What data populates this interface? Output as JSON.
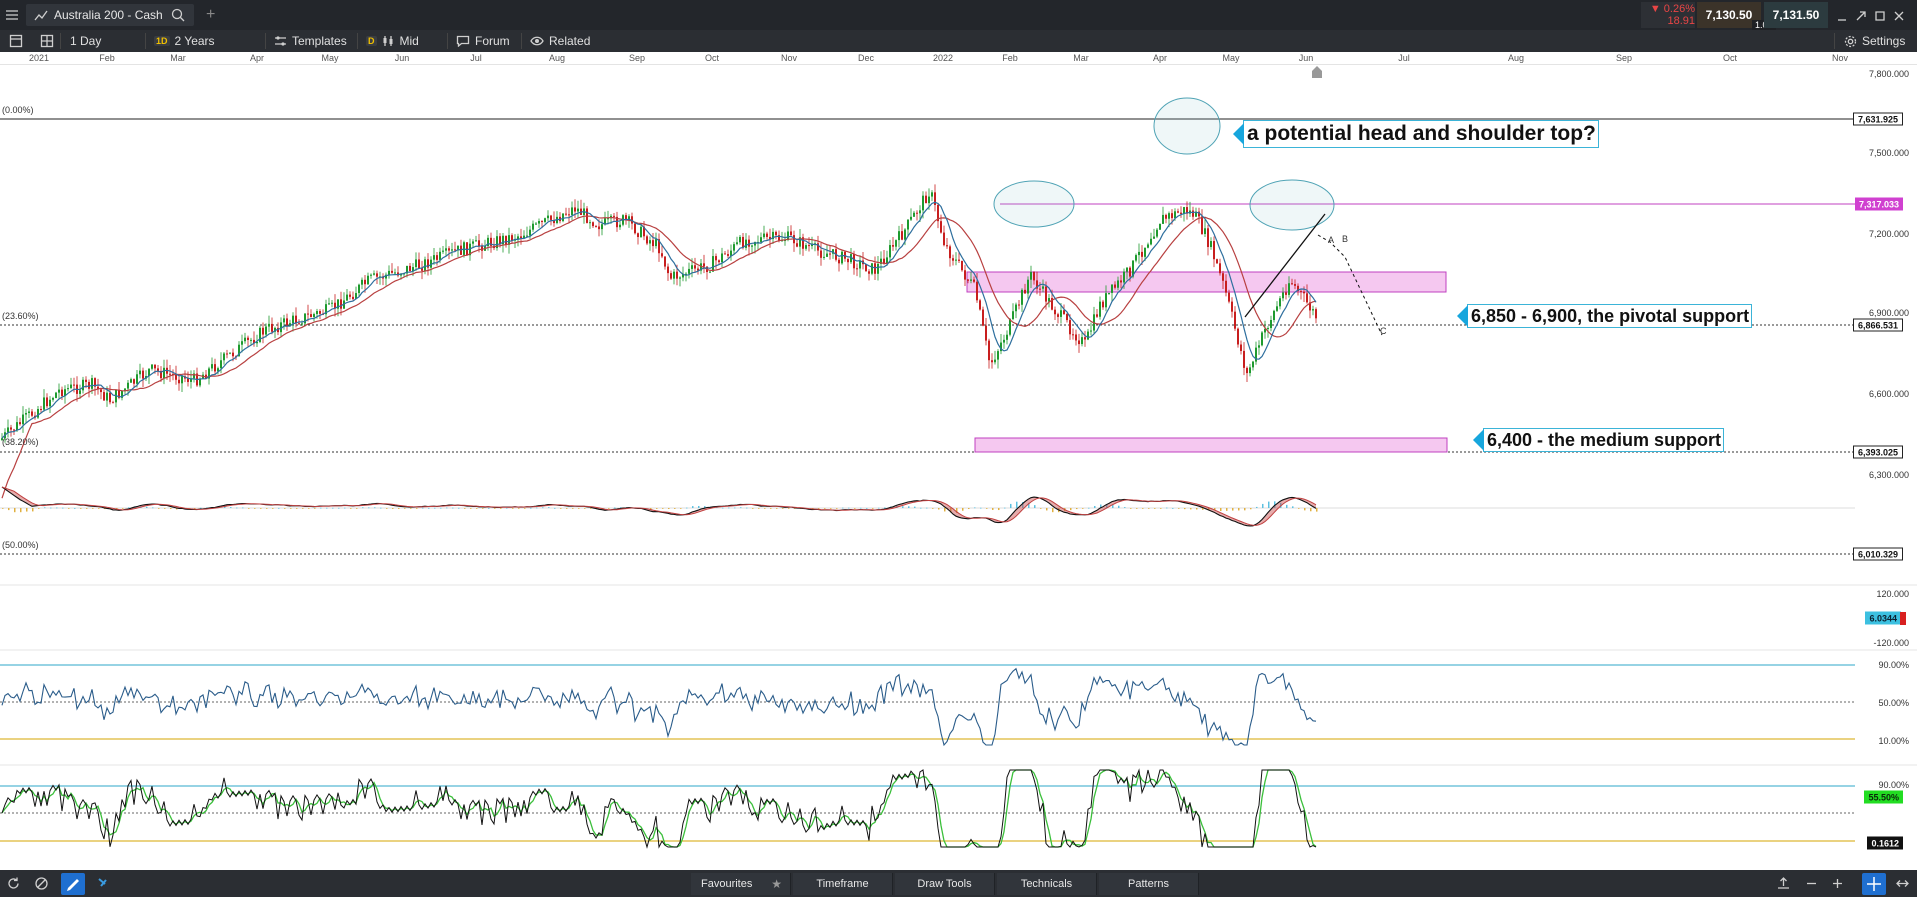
{
  "window": {
    "tab_title": "Australia 200 - Cash",
    "change_pct": "▼ 0.26%",
    "change_pts": "18.91",
    "bid": "7,130.50",
    "ask": "7,131.50",
    "spread": "1.00"
  },
  "toolbar": {
    "interval": "1 Day",
    "range_badge": "1D",
    "range": "2 Years",
    "templates": "Templates",
    "price_badge": "D",
    "price_type": "Mid",
    "forum": "Forum",
    "related": "Related",
    "settings": "Settings"
  },
  "time_axis": [
    "2021",
    "Feb",
    "Mar",
    "Apr",
    "May",
    "Jun",
    "Jul",
    "Aug",
    "Sep",
    "Oct",
    "Nov",
    "Dec",
    "2022",
    "Feb",
    "Mar",
    "Apr",
    "May",
    "Jun",
    "Jul",
    "Aug",
    "Sep",
    "Oct",
    "Nov"
  ],
  "price_axis": {
    "ticks": [
      "7,800.000",
      "7,500.000",
      "7,200.000",
      "6,900.000",
      "6,600.000",
      "6,300.000"
    ],
    "markers": {
      "top_line": "7,631.925",
      "neckline": "7,317.033",
      "fib_236": "6,866.531",
      "fib_382": "6,393.025",
      "fib_50": "6,010.329"
    }
  },
  "fib_labels": [
    "(0.00%)",
    "(23.60%)",
    "(38.20%)",
    "(50.00%)"
  ],
  "annotations": {
    "head_shoulders": "a potential head and shoulder top?",
    "pivotal_support": "6,850 - 6,900, the pivotal support",
    "medium_support": "6,400 - the medium support"
  },
  "wave_labels": [
    "A",
    "B",
    "C"
  ],
  "macd": {
    "ticks": [
      "120.000",
      "-120.000"
    ],
    "value": "6.0344"
  },
  "rsi": {
    "ticks": [
      "90.00%",
      "50.00%",
      "10.00%"
    ]
  },
  "stoch": {
    "ticks": [
      "90.00%"
    ],
    "value": "55.50%",
    "value2": "0.1612"
  },
  "bottom_tabs": [
    "Favourites",
    "Timeframe",
    "Draw Tools",
    "Technicals",
    "Patterns"
  ],
  "colors": {
    "candle_up": "#1e9a2e",
    "candle_down": "#c81e1e",
    "ma_fast": "#2e6f9e",
    "ma_slow": "#b84040",
    "support_zone": "#f5c8f0",
    "annotation_arrow": "#17a6dd",
    "neckline": "#c040c0"
  }
}
